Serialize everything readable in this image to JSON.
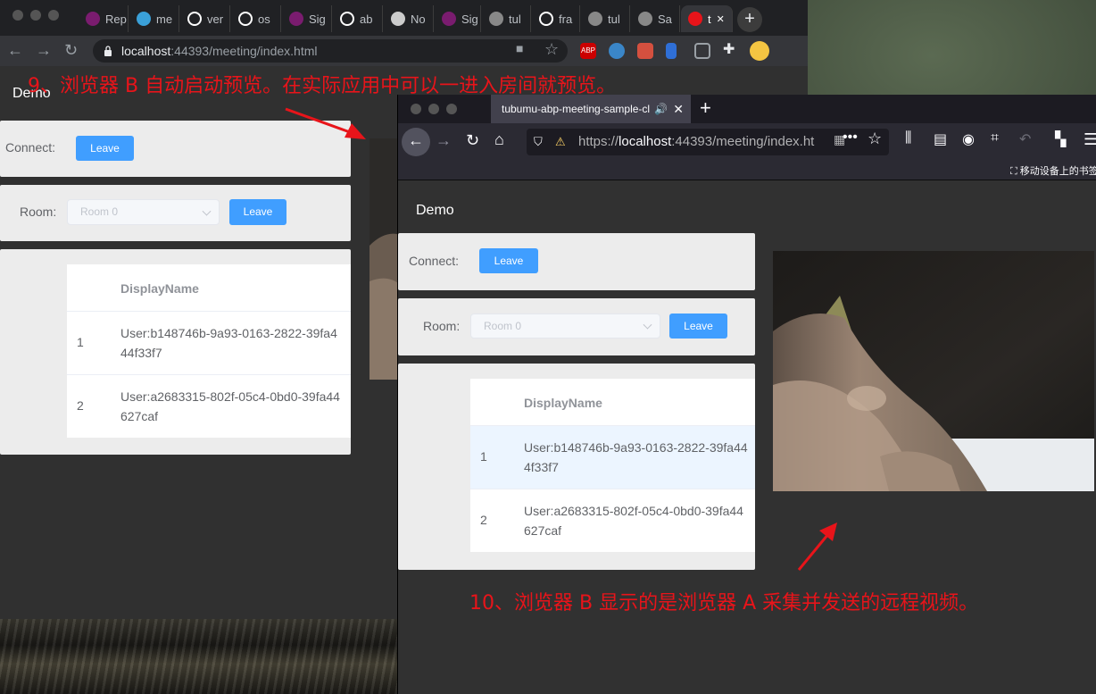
{
  "chrome": {
    "tabs": [
      {
        "label": "Rep",
        "icon": "purple-dot-icon",
        "color": "#7a1c6f"
      },
      {
        "label": "me",
        "icon": "circle-app-icon",
        "color": "#3aa0d8"
      },
      {
        "label": "ver",
        "icon": "github-icon",
        "color": "#ffffff"
      },
      {
        "label": "os",
        "icon": "github-icon",
        "color": "#ffffff"
      },
      {
        "label": "Sig",
        "icon": "purple-dot-icon",
        "color": "#7a1c6f"
      },
      {
        "label": "ab",
        "icon": "github-icon",
        "color": "#ffffff"
      },
      {
        "label": "No",
        "icon": "cat-icon",
        "color": "#cccccc"
      },
      {
        "label": "Sig",
        "icon": "purple-dot-icon",
        "color": "#7a1c6f"
      },
      {
        "label": "tul",
        "icon": "globe-icon",
        "color": "#888888"
      },
      {
        "label": "fra",
        "icon": "github-icon",
        "color": "#ffffff"
      },
      {
        "label": "tul",
        "icon": "globe-icon",
        "color": "#888888"
      },
      {
        "label": "Sa",
        "icon": "globe-icon",
        "color": "#888888"
      },
      {
        "label": "t",
        "icon": "recording-icon",
        "color": "#e8141a"
      }
    ],
    "url": {
      "host": "localhost",
      "rest": ":44393/meeting/index.html"
    },
    "page": {
      "title": "Demo",
      "connect_label": "Connect:",
      "connect_button": "Leave",
      "room_label": "Room:",
      "room_placeholder": "Room 0",
      "room_button": "Leave",
      "table_header": "DisplayName",
      "rows": [
        {
          "index": "1",
          "name": "User:b148746b-9a93-0163-2822-39fa444f33f7"
        },
        {
          "index": "2",
          "name": "User:a2683315-802f-05c4-0bd0-39fa44627caf"
        }
      ]
    }
  },
  "firefox": {
    "tab_title": "tubumu-abp-meeting-sample-cl",
    "url": {
      "scheme": "https://",
      "host": "localhost",
      "rest": ":44393/meeting/index.ht"
    },
    "bookmarks_label": "移动设备上的书签",
    "page": {
      "title": "Demo",
      "connect_label": "Connect:",
      "connect_button": "Leave",
      "room_label": "Room:",
      "room_placeholder": "Room 0",
      "room_button": "Leave",
      "table_header": "DisplayName",
      "rows": [
        {
          "index": "1",
          "name": "User:b148746b-9a93-0163-2822-39fa444f33f7",
          "highlighted": true
        },
        {
          "index": "2",
          "name": "User:a2683315-802f-05c4-0bd0-39fa44627caf",
          "highlighted": false
        }
      ]
    }
  },
  "annotations": {
    "step9": "9、浏览器 B 自动启动预览。在实际应用中可以一进入房间就预览。",
    "step10": "10、浏览器 B 显示的是浏览器 A 采集并发送的远程视频。",
    "color": "#e8141a"
  },
  "colors": {
    "accent": "#409eff",
    "panel": "#ececec",
    "page_bg": "#303030"
  }
}
